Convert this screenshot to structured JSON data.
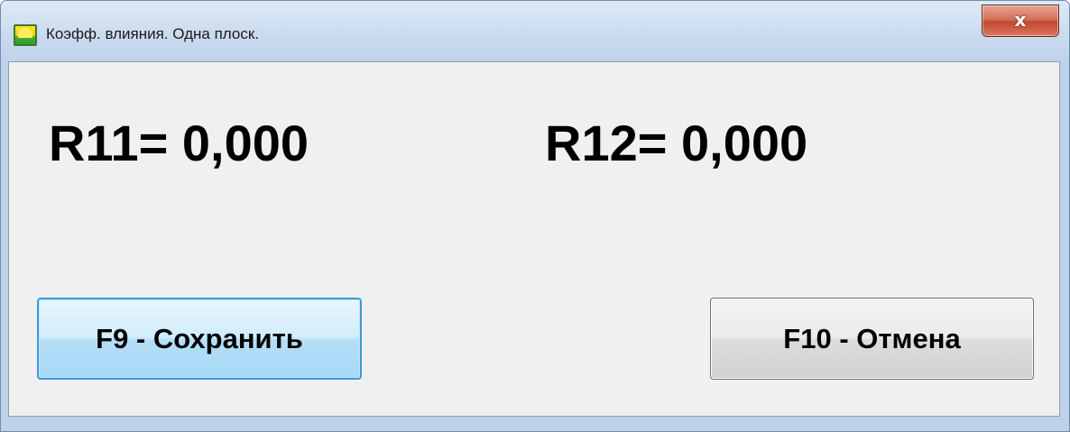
{
  "window": {
    "title": "Коэфф. влияния. Одна плоск.",
    "close_label": "x"
  },
  "coefficients": {
    "r11": "R11= 0,000",
    "r12": "R12= 0,000"
  },
  "buttons": {
    "save_label": "F9 - Сохранить",
    "cancel_label": "F10 - Отмена"
  },
  "colors": {
    "accent_save_border": "#3c9bd6",
    "close_button": "#c24a32",
    "client_background": "#f0f0f0"
  },
  "icons": {
    "app": "sunrise-app-icon",
    "close": "close-icon"
  }
}
